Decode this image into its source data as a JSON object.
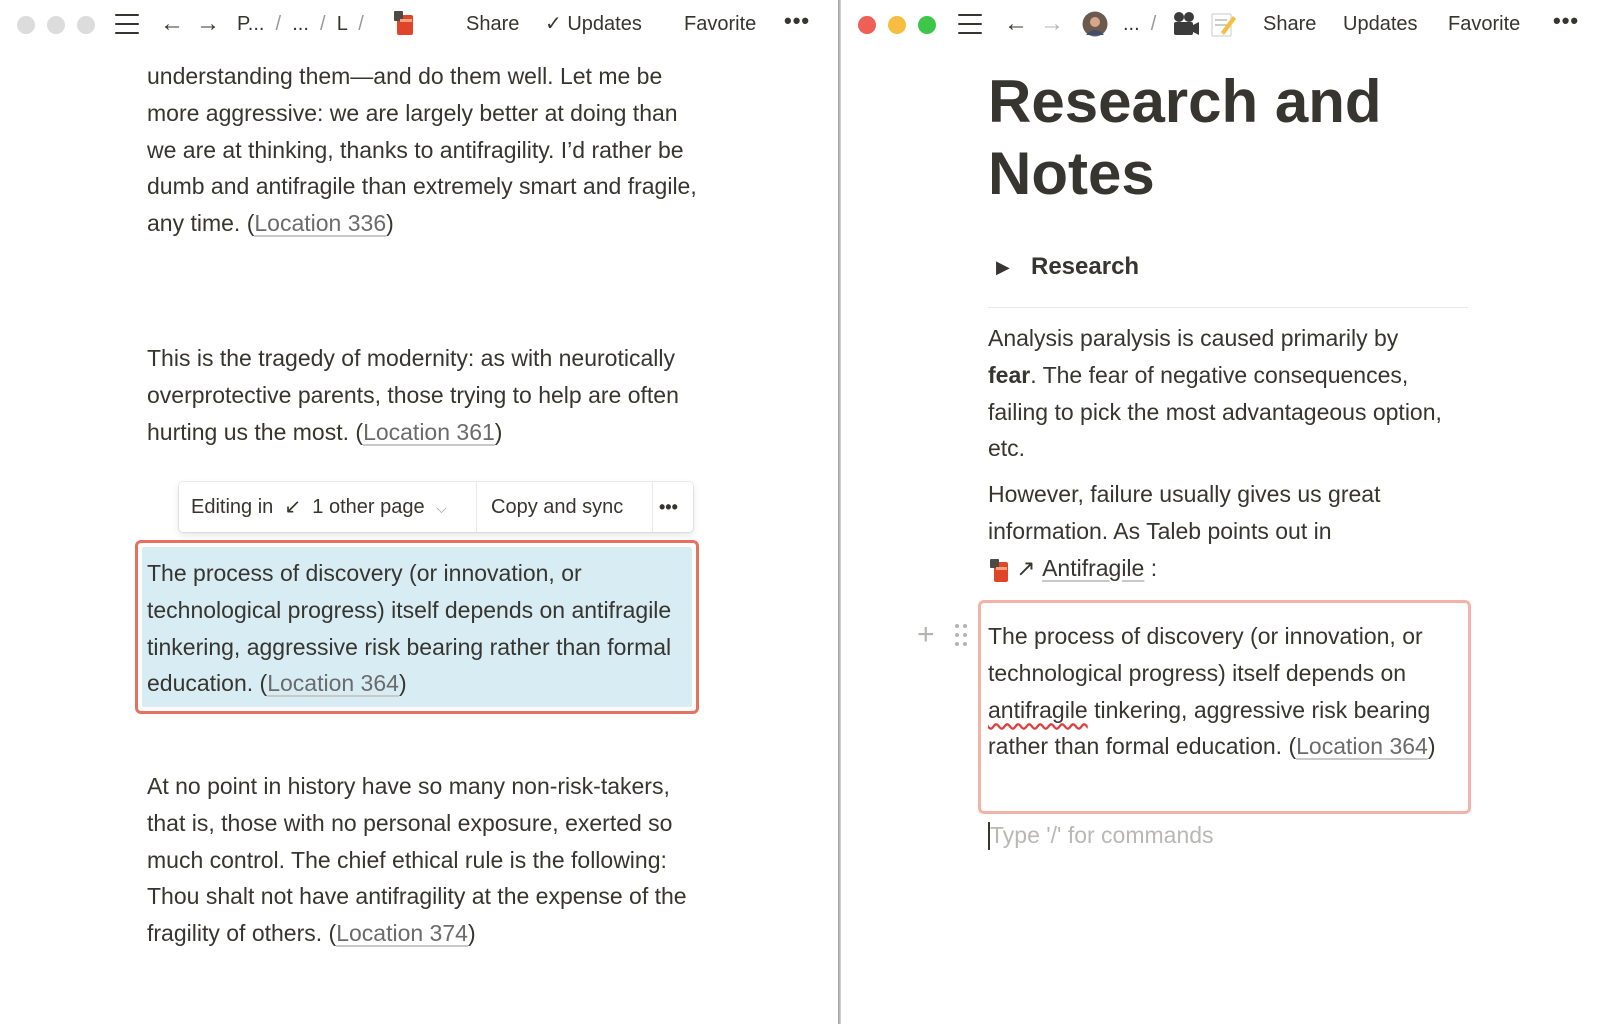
{
  "left": {
    "topbar": {
      "crumbs": [
        "P...",
        "...",
        "L"
      ],
      "share": "Share",
      "updates": "Updates",
      "favorite": "Favorite",
      "more": "•••"
    },
    "blocks": [
      {
        "text": "understanding them—and do them well. Let me be more aggressive: we are largely better at doing than we are at thinking, thanks to antifragility. I’d rather be dumb and antifragile than extremely smart and fragile, any time.",
        "location": "Location 336"
      },
      {
        "text": "This is the tragedy of modernity: as with neurotically overprotective parents, those trying to help are often hurting us the most.",
        "location": "Location 361"
      },
      {
        "text": "The process of discovery (or innovation, or technological progress) itself depends on antifragile tinkering, aggressive risk bearing rather than formal education.",
        "location": "Location 364"
      },
      {
        "text": "At no point in history have so many non-risk-takers, that is, those with no personal exposure, exerted so much control. The chief ethical rule is the following: Thou shalt not have antifragility at the expense of the fragility of others.",
        "location": "Location 374"
      }
    ],
    "sync_toolbar": {
      "editing_prefix": "Editing in",
      "editing_target": "1 other page",
      "copy_and_sync": "Copy and sync",
      "more": "•••"
    }
  },
  "right": {
    "topbar": {
      "crumbs": [
        "..."
      ],
      "share": "Share",
      "updates": "Updates",
      "favorite": "Favorite",
      "more": "•••"
    },
    "title": "Research and Notes",
    "toggle_label": "Research",
    "para1_pre": "Analysis paralysis is caused primarily by ",
    "para1_bold": "fear",
    "para1_post": ". The fear of negative consequences, failing to pick the most advantageous option, etc.",
    "para2": "However, failure usually gives us great information. As Taleb points out in",
    "link_page": "Antifragile",
    "link_suffix": " :",
    "synced_text_pre": "The process of discovery (or innovation, or technological progress) itself depends on ",
    "synced_text_word": "antifragile",
    "synced_text_post": " tinkering, aggressive risk bearing rather than formal education.",
    "synced_location": "Location 364",
    "placeholder": "Type '/' for commands"
  },
  "colors": {
    "text": "#37352f",
    "synced_border": "#e6715f",
    "synced_highlight": "#d8ecf4",
    "close": "#ee5f55",
    "minimize": "#f6bd40",
    "zoom": "#3ec64a"
  },
  "icons": [
    "hamburger-icon",
    "back-arrow-icon",
    "forward-arrow-icon",
    "book-cover-icon",
    "check-icon",
    "chevron-down-icon",
    "link-arrow-icon",
    "avatar",
    "film-camera-icon",
    "memo-icon",
    "plus-icon",
    "drag-handle-icon"
  ]
}
